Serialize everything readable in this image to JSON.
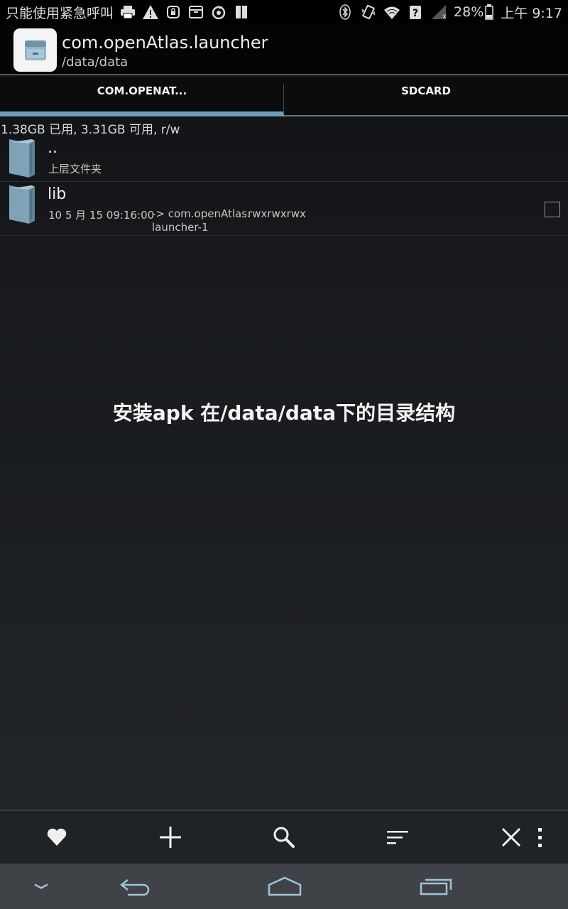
{
  "status_bar": {
    "carrier_text": "只能使用紧急呼叫",
    "battery_percent": "28%",
    "time": "上午 9:17",
    "icons_left": [
      "print-icon",
      "warning-icon",
      "lock-icon",
      "archive-icon",
      "sync-icon",
      "sim-icon"
    ],
    "icons_right": [
      "bluetooth-icon",
      "vibrate-icon",
      "wifi-icon",
      "unknown-signal-icon",
      "no-signal-icon",
      "battery-icon"
    ]
  },
  "action_bar": {
    "title": "com.openAtlas.launcher",
    "subtitle": "/data/data",
    "app_icon": "file-manager-icon"
  },
  "tabs": [
    {
      "label": "COM.OPENAT...",
      "active": true
    },
    {
      "label": "SDCARD",
      "active": false
    }
  ],
  "storage_info": "1.38GB 已用, 3.31GB 可用, r/w",
  "files": {
    "parent": {
      "name": "..",
      "sub": "上层文件夹",
      "icon": "folder-icon"
    },
    "lib": {
      "name": "lib",
      "date": "10 5 月 15 09:16:00",
      "link_line1": "-> com.openAtlas.",
      "link_line2": "launcher-1",
      "permissions": "rwxrwxrwx",
      "icon": "folder-icon",
      "checked": false
    }
  },
  "caption": "安装apk 在/data/data下的目录结构",
  "toolbar": {
    "buttons": [
      "favorite-icon",
      "add-icon",
      "search-icon",
      "sort-icon",
      "close-icon",
      "more-icon"
    ]
  },
  "nav_bar": {
    "buttons": [
      "hide-keyboard-icon",
      "back-icon",
      "home-icon",
      "recents-icon"
    ]
  },
  "colors": {
    "accent": "#6f9fb8",
    "background": "#1b1d20",
    "folder": "#8fb5c9"
  }
}
